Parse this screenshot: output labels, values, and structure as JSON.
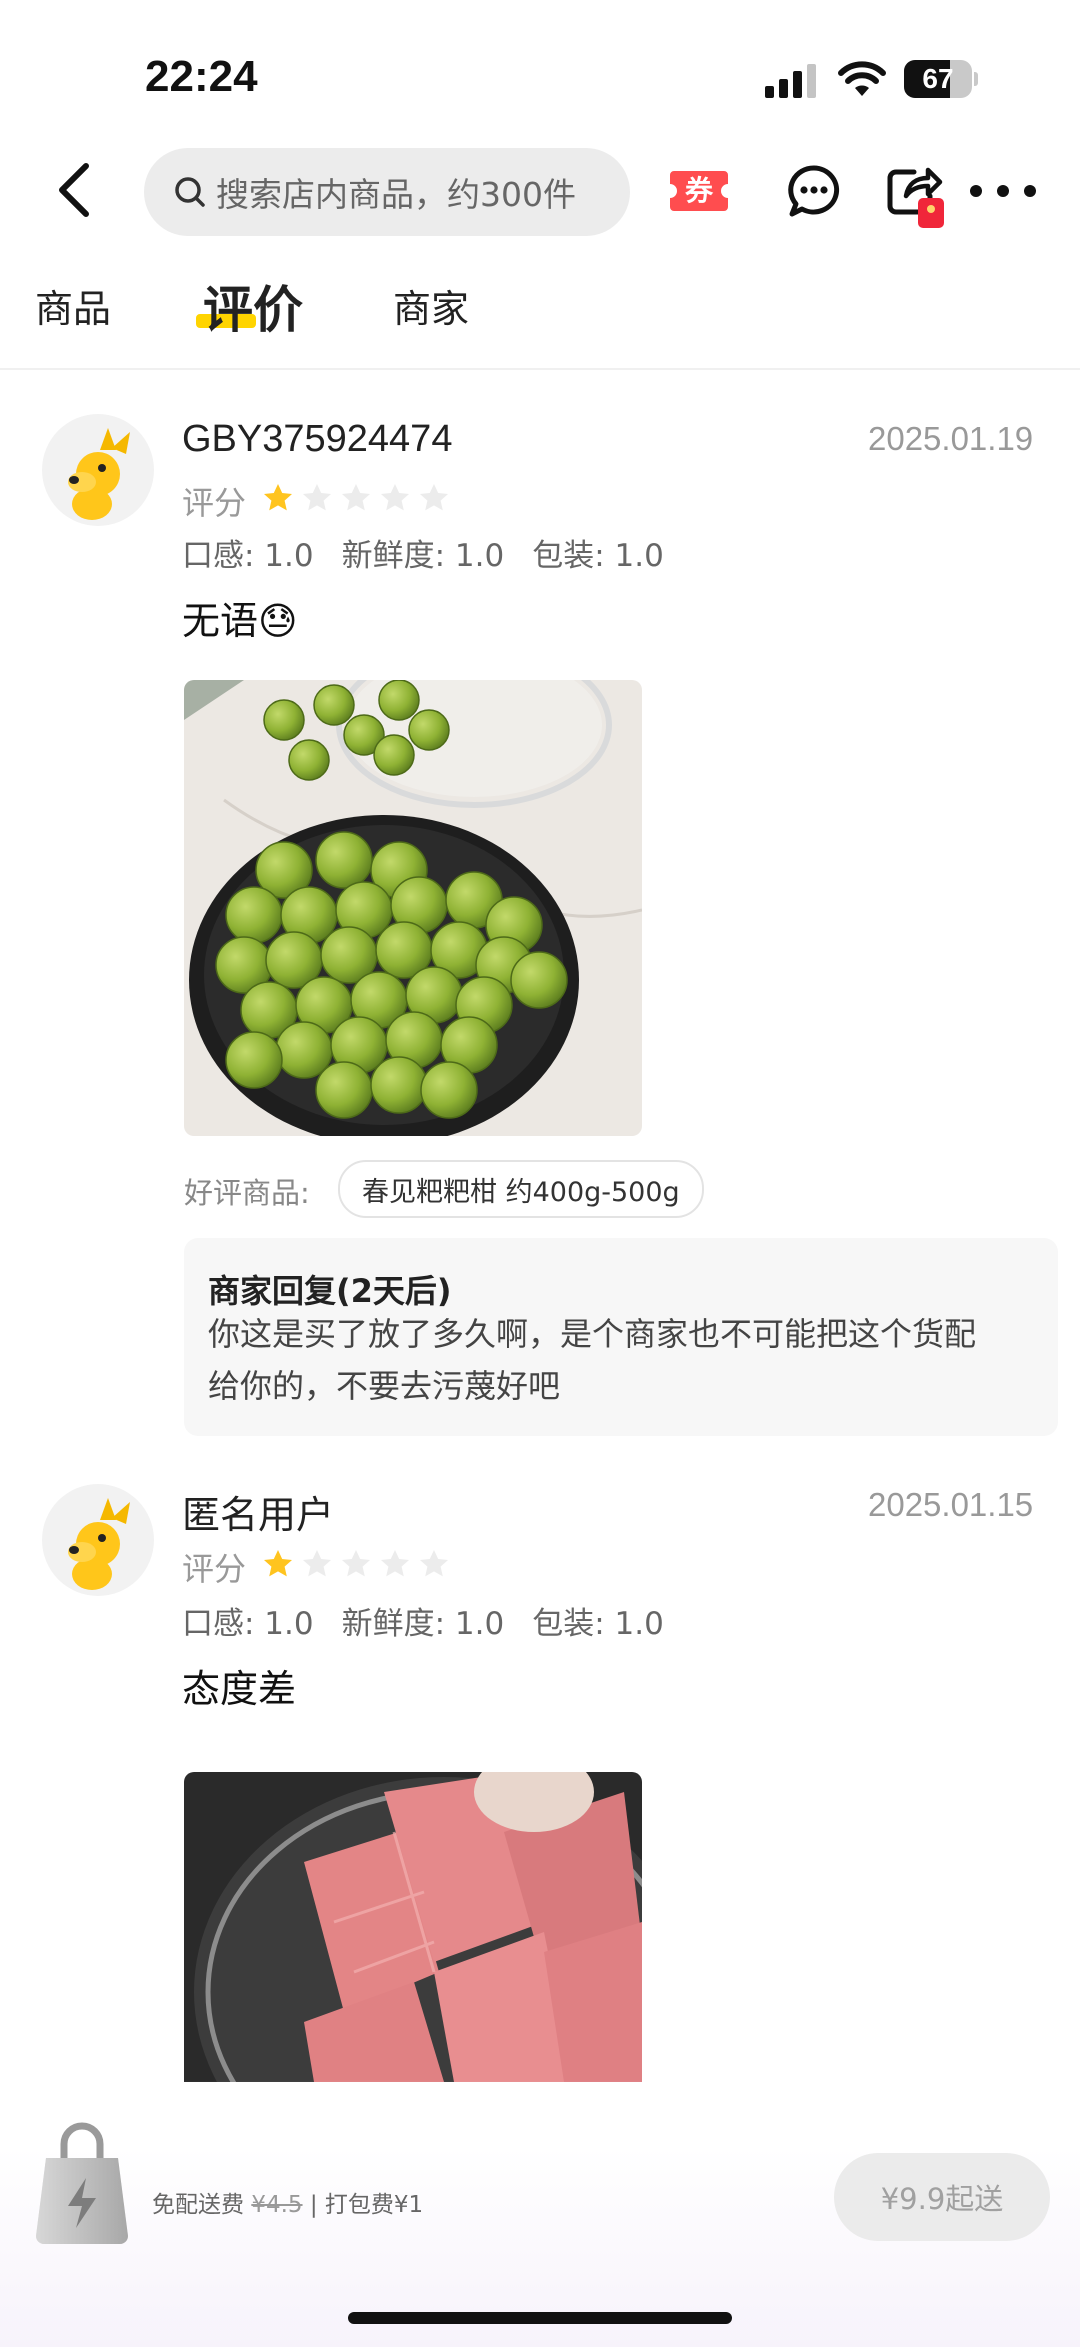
{
  "status_bar": {
    "time": "22:24",
    "battery": "67",
    "battery_level": 0.67
  },
  "search": {
    "placeholder": "搜索店内商品，约300件"
  },
  "header": {
    "coupon_label": "券"
  },
  "tabs": [
    {
      "label": "商品"
    },
    {
      "label": "评价",
      "active": true
    },
    {
      "label": "商家"
    }
  ],
  "reviews": [
    {
      "username": "GBY375924474",
      "date": "2025.01.19",
      "rating_label": "评分",
      "stars": 1,
      "stars_max": 5,
      "subscores": {
        "taste": "口感: 1.0",
        "freshness": "新鲜度: 1.0",
        "packaging": "包装: 1.0"
      },
      "text": "无语😓",
      "photo": "green-fruits-in-black-bowl",
      "good_label": "好评商品:",
      "product": "春见粑粑柑 约400g-500g",
      "reply": {
        "title": "商家回复(2天后)",
        "line1": "你这是买了放了多久啊，是个商家也不可能把这个货配",
        "line2": "给你的，不要去污蔑好吧"
      }
    },
    {
      "username": "匿名用户",
      "date": "2025.01.15",
      "rating_label": "评分",
      "stars": 1,
      "stars_max": 5,
      "subscores": {
        "taste": "口感: 1.0",
        "freshness": "新鲜度: 1.0",
        "packaging": "包装: 1.0"
      },
      "text": "态度差",
      "photo": "watermelon-slices-in-container"
    }
  ],
  "bottom_bar": {
    "free_delivery": "免配送费",
    "original_fee": "¥4.5",
    "separator": "|",
    "packing_fee": "打包费¥1",
    "checkout_label": "¥9.9起送"
  },
  "colors": {
    "accent_yellow": "#ffd400",
    "star_active": "#ffc41f",
    "star_inactive": "#ececec",
    "coupon_red": "#ff4d4f"
  }
}
